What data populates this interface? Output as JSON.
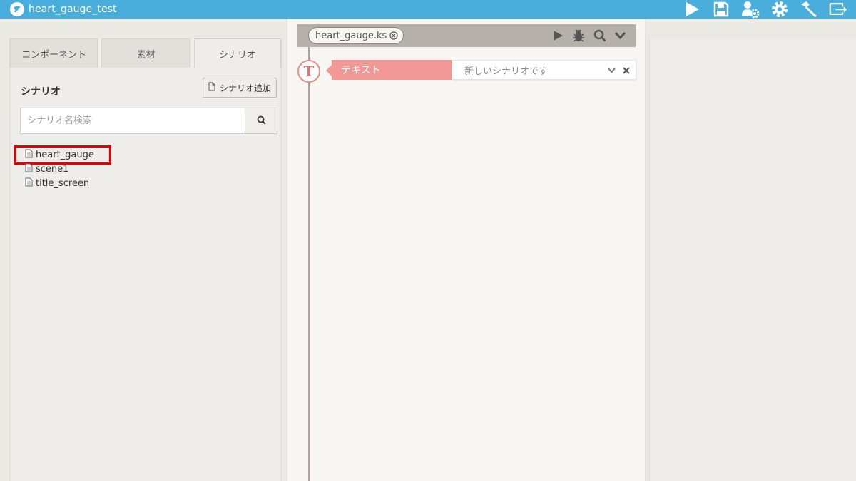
{
  "app": {
    "title": "heart_gauge_test",
    "logo_icon": "app-logo-icon",
    "accent_color": "#4aaedc"
  },
  "toolbar": {
    "icons": [
      "play-icon",
      "save-icon",
      "user-settings-icon",
      "gear-icon",
      "hammer-icon",
      "export-icon"
    ]
  },
  "left_panel": {
    "tabs": [
      {
        "label": "コンポーネント",
        "active": false
      },
      {
        "label": "素材",
        "active": false
      },
      {
        "label": "シナリオ",
        "active": true
      }
    ],
    "title": "シナリオ",
    "add_button_label": "シナリオ追加",
    "search": {
      "placeholder": "シナリオ名検索",
      "value": ""
    },
    "files": [
      {
        "name": "heart_gauge",
        "highlighted": true
      },
      {
        "name": "scene1",
        "highlighted": false
      },
      {
        "name": "title_screen",
        "highlighted": false
      }
    ]
  },
  "editor": {
    "file_tab": "heart_gauge.ks",
    "toolbar_icons": [
      "run-icon",
      "debug-bug-icon",
      "search-icon",
      "chevron-down-icon"
    ],
    "tag": {
      "label": "テキスト",
      "value": "新しいシナリオです",
      "icon_letter": "T",
      "color": "#f29897"
    }
  }
}
